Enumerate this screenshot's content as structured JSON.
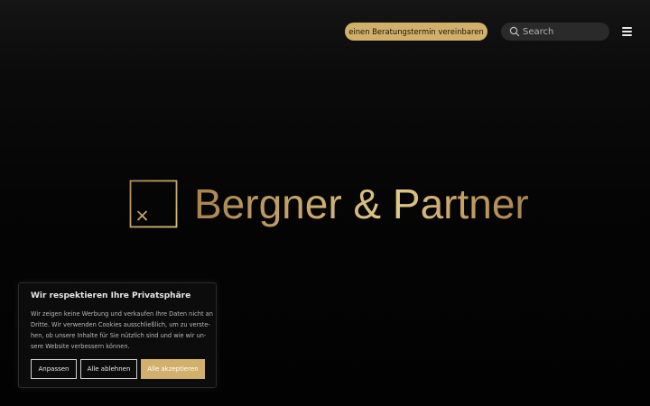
{
  "header": {
    "cta_label": "einen Beratungstermin vereinbaren",
    "search_placeholder": "Search",
    "menu_icon": "hamburger-menu-icon",
    "search_icon": "magnifier-icon"
  },
  "brand": {
    "name": "Bergner & Partner",
    "mark_icon": "calculator-symbols-icon"
  },
  "cookie_banner": {
    "title": "Wir respektieren Ihre Privatsphäre",
    "text_lines": [
      "Wir zeigen keine Werbung und verkaufen Ihre Daten nicht an",
      "Dritte. Wir verwenden Cookies ausschließlich, um zu verste-",
      "hen, ob unsere Inhalte für Sie nützlich sind und wie wir un-",
      "sere Website verbessern können."
    ],
    "buttons": {
      "customize": "Anpassen",
      "reject_all": "Alle ablehnen",
      "accept_all": "Alle akzeptieren"
    }
  },
  "colors": {
    "accent_gold": "#d2b06b",
    "background": "#050505",
    "search_bg": "#2a2a2a"
  }
}
